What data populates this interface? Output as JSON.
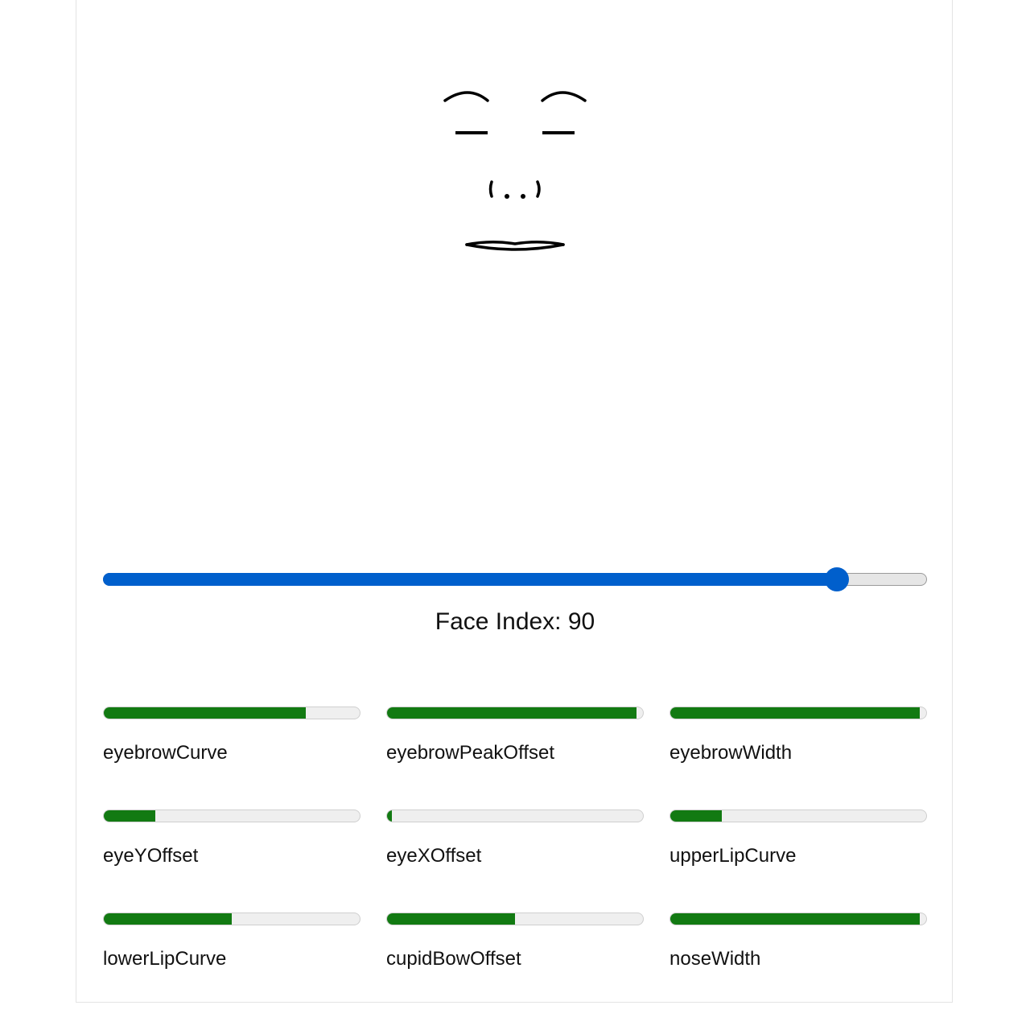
{
  "face": {
    "index": 90,
    "label_prefix": "Face Index: ",
    "label": "Face Index: 90"
  },
  "slider": {
    "value": 90,
    "min": 0,
    "max": 101,
    "accent_color": "#005fcc"
  },
  "params": {
    "fill_color": "#127a12",
    "items": [
      {
        "name": "eyebrowCurve",
        "value": 0.79
      },
      {
        "name": "eyebrowPeakOffset",
        "value": 0.975
      },
      {
        "name": "eyebrowWidth",
        "value": 0.975
      },
      {
        "name": "eyeYOffset",
        "value": 0.2
      },
      {
        "name": "eyeXOffset",
        "value": 0.02
      },
      {
        "name": "upperLipCurve",
        "value": 0.2
      },
      {
        "name": "lowerLipCurve",
        "value": 0.5
      },
      {
        "name": "cupidBowOffset",
        "value": 0.5
      },
      {
        "name": "noseWidth",
        "value": 0.975
      }
    ]
  }
}
